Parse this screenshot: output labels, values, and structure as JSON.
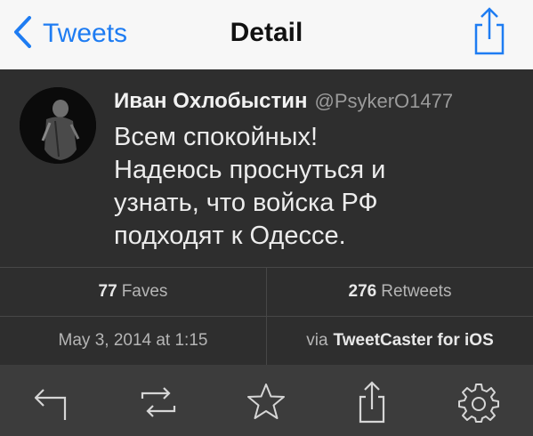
{
  "navbar": {
    "back_label": "Tweets",
    "title": "Detail",
    "back_icon": "chevron-left-icon",
    "share_icon": "share-icon"
  },
  "tweet": {
    "author_name": "Иван Охлобыстин",
    "author_handle": "@PsykerO1477",
    "text_lines": [
      "Всем спокойных!",
      "Надеюсь проснуться и",
      "узнать, что войска РФ",
      "подходят к Одессе."
    ]
  },
  "stats": {
    "faves_count": "77",
    "faves_label": "Faves",
    "retweets_count": "276",
    "retweets_label": "Retweets",
    "date": "May 3, 2014 at 1:15",
    "via_label": "via",
    "via_app": "TweetCaster for iOS"
  },
  "toolbar": {
    "icons": [
      "reply-icon",
      "retweet-icon",
      "favorite-star-icon",
      "share-icon",
      "settings-gear-icon"
    ]
  },
  "colors": {
    "accent": "#1e7cf2",
    "nav_background": "#f7f7f7",
    "content_background": "#2e2e2e",
    "toolbar_background": "#3c3c3c",
    "divider": "#474747"
  }
}
